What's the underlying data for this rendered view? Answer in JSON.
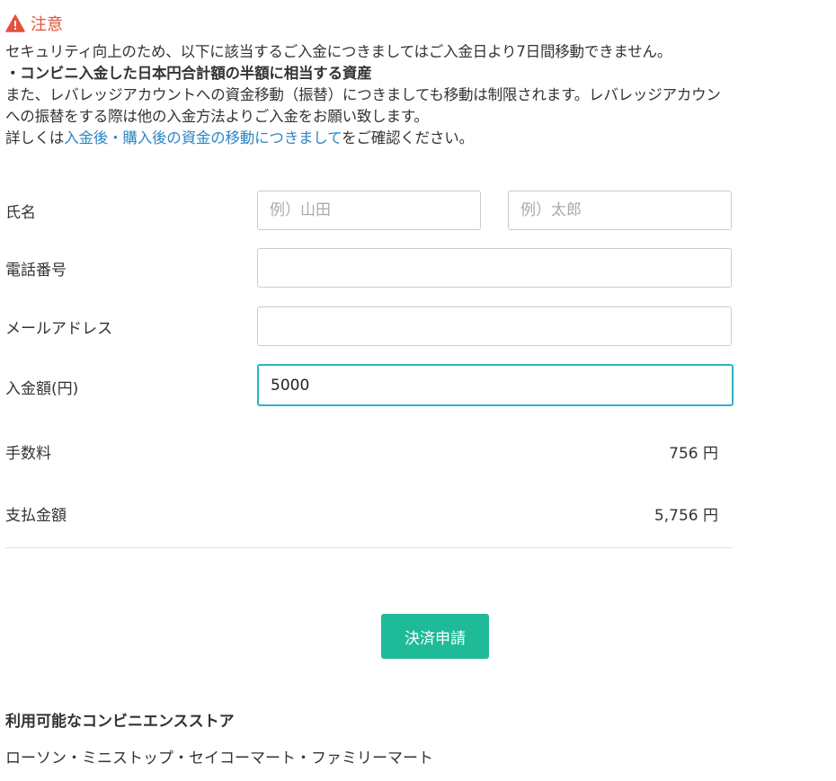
{
  "notice": {
    "title": "注意",
    "line1": "セキュリティ向上のため、以下に該当するご入金につきましてはご入金日より7日間移動できません。",
    "line2": "・コンビニ入金した日本円合計額の半額に相当する資産",
    "line3": "また、レバレッジアカウントへの資金移動（振替）につきましても移動は制限されます。レバレッジアカウン",
    "line4": "への振替をする際は他の入金方法よりご入金をお願い致します。",
    "line5_prefix": "詳しくは",
    "line5_link": "入金後・購入後の資金の移動につきまして",
    "line5_suffix": "をご確認ください。"
  },
  "colors": {
    "warning": "#e4503c",
    "link": "#2b87c4",
    "focus_border": "#2bb5c8",
    "submit_button": "#1fba97"
  },
  "icons": {
    "notice": "warning-triangle-icon"
  },
  "form": {
    "name_label": "氏名",
    "last_name_placeholder": "例）山田",
    "first_name_placeholder": "例）太郎",
    "phone_label": "電話番号",
    "phone_value": "",
    "email_label": "メールアドレス",
    "email_value": "",
    "amount_label": "入金額(円)",
    "amount_value": "5000"
  },
  "summary": {
    "fee_label": "手数料",
    "fee_value": "756 円",
    "total_label": "支払金額",
    "total_value": "5,756 円"
  },
  "submit_label": "決済申請",
  "stores": {
    "title": "利用可能なコンビニエンスストア",
    "list": "ローソン・ミニストップ・セイコーマート・ファミリーマート"
  }
}
